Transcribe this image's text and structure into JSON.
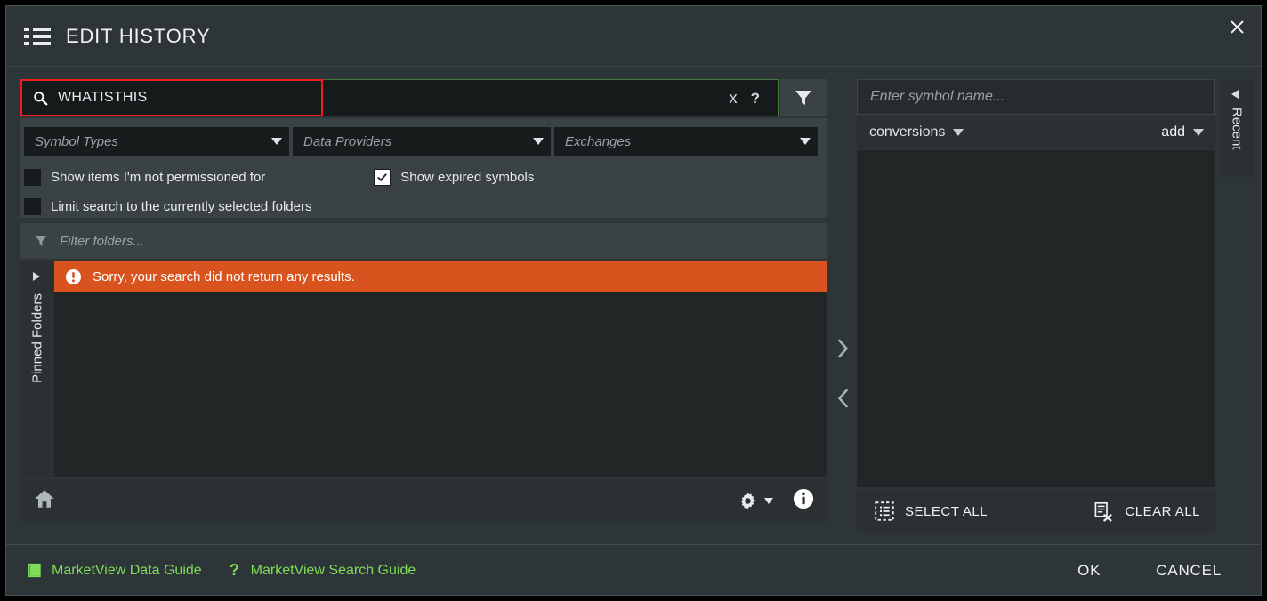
{
  "window": {
    "title": "EDIT HISTORY",
    "title_icon": "list-icon",
    "close_icon": "close-icon"
  },
  "search": {
    "icon": "search-icon",
    "value": "WHATISTHIS",
    "clear_icon": "x",
    "help_icon": "?",
    "filter_icon": "funnel-icon",
    "highlight_color": "#ee1c1c",
    "border_color": "#3f7a3f"
  },
  "selects": [
    {
      "name": "symbol-types",
      "placeholder": "Symbol Types"
    },
    {
      "name": "data-providers",
      "placeholder": "Data Providers"
    },
    {
      "name": "exchanges",
      "placeholder": "Exchanges"
    }
  ],
  "checkboxes": [
    {
      "name": "show-not-permissioned",
      "label": "Show items I'm not permissioned for",
      "checked": false
    },
    {
      "name": "show-expired-symbols",
      "label": "Show expired symbols",
      "checked": true
    },
    {
      "name": "limit-search-folders",
      "label": "Limit search to the currently selected folders",
      "checked": false
    }
  ],
  "folder_filter": {
    "icon": "funnel-icon",
    "placeholder": "Filter folders..."
  },
  "pinned_folders": {
    "label": "Pinned Folders",
    "expand_icon": "chevron-right-icon"
  },
  "results": {
    "alert_icon": "exclamation-circle-icon",
    "alert_text": "Sorry, your search did not return any results.",
    "alert_color": "#d9531e"
  },
  "left_toolbar": {
    "home_icon": "home-icon",
    "gear_icon": "gear-icon",
    "gear_caret_icon": "caret-down-icon",
    "info_icon": "info-icon"
  },
  "transfer": {
    "add_icon": "chevron-right-icon",
    "remove_icon": "chevron-left-icon"
  },
  "right_panel": {
    "symbol_placeholder": "Enter symbol name...",
    "list_name": "conversions",
    "list_caret_icon": "caret-down-icon",
    "add_label": "add",
    "add_caret_icon": "caret-down-icon",
    "select_all_label": "SELECT ALL",
    "select_all_icon": "select-all-icon",
    "clear_all_label": "CLEAR ALL",
    "clear_all_icon": "clear-all-icon"
  },
  "recent": {
    "label": "Recent",
    "collapse_icon": "chevron-left-icon"
  },
  "footer": {
    "data_guide_label": "MarketView Data Guide",
    "data_guide_icon": "book-icon",
    "search_guide_label": "MarketView Search Guide",
    "search_guide_icon": "question-icon",
    "link_color": "#7ede57",
    "ok_label": "OK",
    "cancel_label": "CANCEL"
  }
}
